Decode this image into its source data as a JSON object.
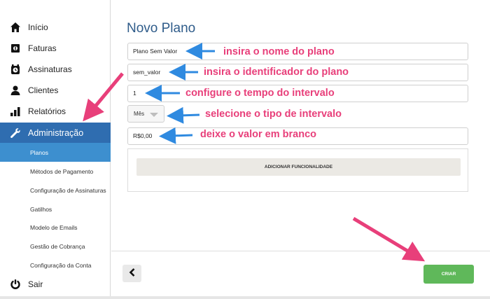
{
  "sidebar": {
    "items": [
      {
        "label": "Início",
        "icon": "home-icon"
      },
      {
        "label": "Faturas",
        "icon": "invoice-icon"
      },
      {
        "label": "Assinaturas",
        "icon": "alarm-clock-icon"
      },
      {
        "label": "Clientes",
        "icon": "user-icon"
      },
      {
        "label": "Relatórios",
        "icon": "bar-chart-icon"
      },
      {
        "label": "Administração",
        "icon": "wrench-icon"
      }
    ],
    "subitems": [
      {
        "label": "Planos"
      },
      {
        "label": "Métodos de Pagamento"
      },
      {
        "label": "Configuração de Assinaturas"
      },
      {
        "label": "Gatilhos"
      },
      {
        "label": "Modelo de Emails"
      },
      {
        "label": "Gestão de Cobrança"
      },
      {
        "label": "Configuração da Conta"
      }
    ],
    "logout": {
      "label": "Sair",
      "icon": "power-icon"
    }
  },
  "main": {
    "title": "Novo Plano",
    "name_value": "Plano Sem Valor",
    "identifier_value": "sem_valor",
    "interval_value": "1",
    "interval_type": "Mês",
    "price_value": "R$0,00",
    "add_feature_label": "ADICIONAR FUNCIONALIDADE",
    "save_label": "CRIAR"
  },
  "annotations": {
    "name": "insira o nome do plano",
    "identifier": "insira o identificador do plano",
    "interval": "configure o tempo do intervalo",
    "interval_type": "selecione o tipo de intervalo",
    "price": "deixe o valor em branco"
  },
  "colors": {
    "accent": "#2f6db0",
    "submenu_active": "#3d8fcf",
    "save": "#5fb85a",
    "annotation": "#e83f7a",
    "arrow_blue": "#2f8ae0"
  }
}
